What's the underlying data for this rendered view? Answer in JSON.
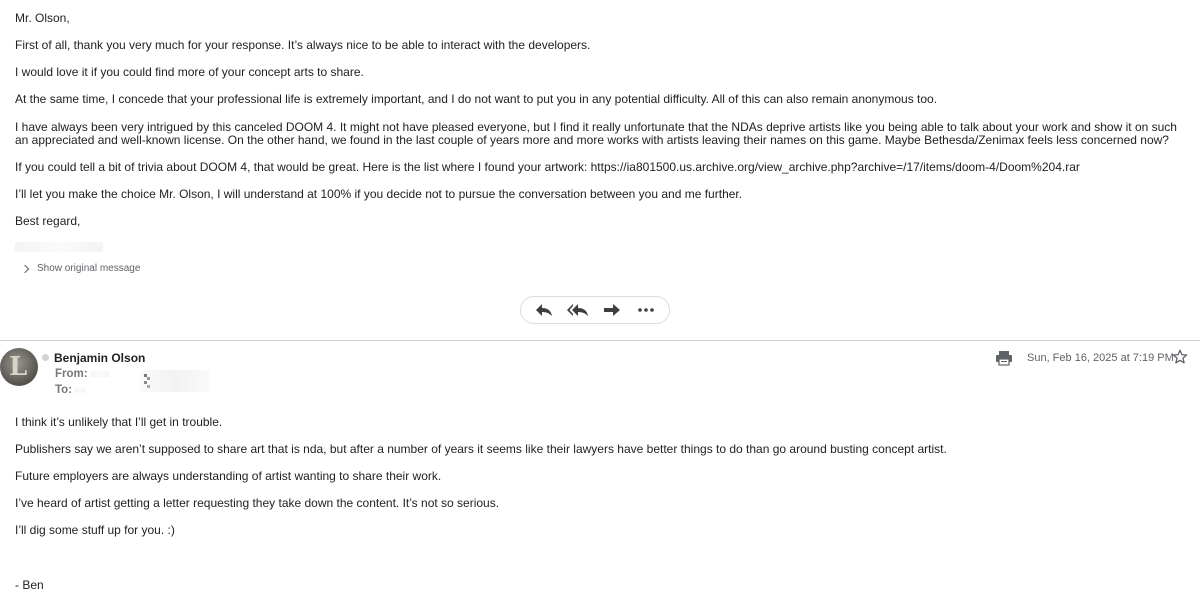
{
  "first_message": {
    "greeting": "Mr. Olson,",
    "paragraphs": [
      "First of all, thank you very much for your response. It’s always nice to be able to interact with the developers.",
      "I would love it if you could find more of your concept arts to share.",
      "At the same time, I concede that your professional life is extremely important, and I do not want to put you in any potential difficulty. All of this can also remain anonymous too.",
      "I have always been very intrigued by this canceled DOOM 4. It might not have pleased everyone, but I find it really unfortunate that the NDAs deprive artists like you being able to talk about your work and show it on such an appreciated and well-known license. On the other hand, we found in the last couple of years more and more works with artists leaving their names on this game. Maybe Bethesda/Zenimax feels less concerned now?",
      "If you could tell a bit of trivia about DOOM 4, that would be great. Here is the list where I found your artwork: https://ia801500.us.archive.org/view_archive.php?archive=/17/items/doom-4/Doom%204.rar",
      "I’ll let you make the choice Mr. Olson, I will understand at 100% if you decide not to pursue the conversation between you and me further."
    ],
    "closing": "Best regard,"
  },
  "show_original_label": "Show original message",
  "action_bar": {
    "icons": [
      "reply-icon",
      "reply-all-icon",
      "forward-icon",
      "more-icon"
    ]
  },
  "reply_message": {
    "sender_name": "Benjamin Olson",
    "from_label": "From:",
    "to_label": "To:",
    "date": "Sun, Feb 16, 2025 at 7:19 PM",
    "body": [
      "I think it’s unlikely that I’ll get in trouble.",
      "Publishers say we aren’t supposed to share art that is nda, but after a number of years it seems like their lawyers have better things to do than go around busting concept artist.",
      "Future employers are always understanding of artist wanting to share their work.",
      "I’ve heard of artist getting a letter requesting they take down the content. It’s not so serious.",
      "I’ll dig some stuff up for you. :)"
    ],
    "signature": "- Ben"
  },
  "colors": {
    "text": "#222222",
    "muted": "#5f6368",
    "divider": "#cfcfcf"
  }
}
